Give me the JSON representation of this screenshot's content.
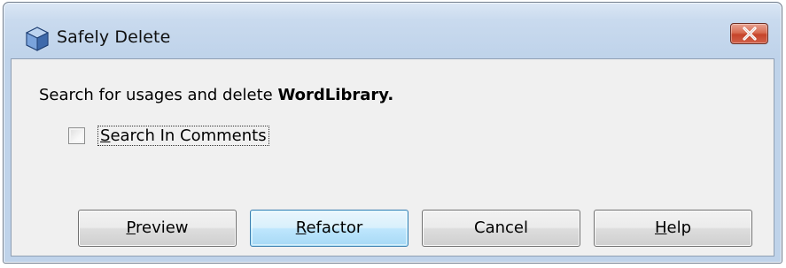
{
  "window": {
    "title": "Safely Delete",
    "title_icon": "netbeans-cube-icon",
    "close_icon": "close-icon"
  },
  "message": {
    "prefix": "Search for usages and delete ",
    "target": "WordLibrary."
  },
  "options": {
    "search_in_comments": {
      "mnemonic": "S",
      "rest": "earch In Comments",
      "checked": false
    }
  },
  "buttons": {
    "preview": {
      "mnemonic": "P",
      "rest": "review"
    },
    "refactor": {
      "mnemonic": "R",
      "rest": "efactor"
    },
    "cancel": {
      "label": "Cancel"
    },
    "help": {
      "mnemonic": "H",
      "rest": "elp"
    }
  },
  "colors": {
    "title_bar": "#c9daee",
    "close_button": "#c6442a",
    "default_button": "#bee6fd",
    "client_bg": "#f0f0f0"
  }
}
